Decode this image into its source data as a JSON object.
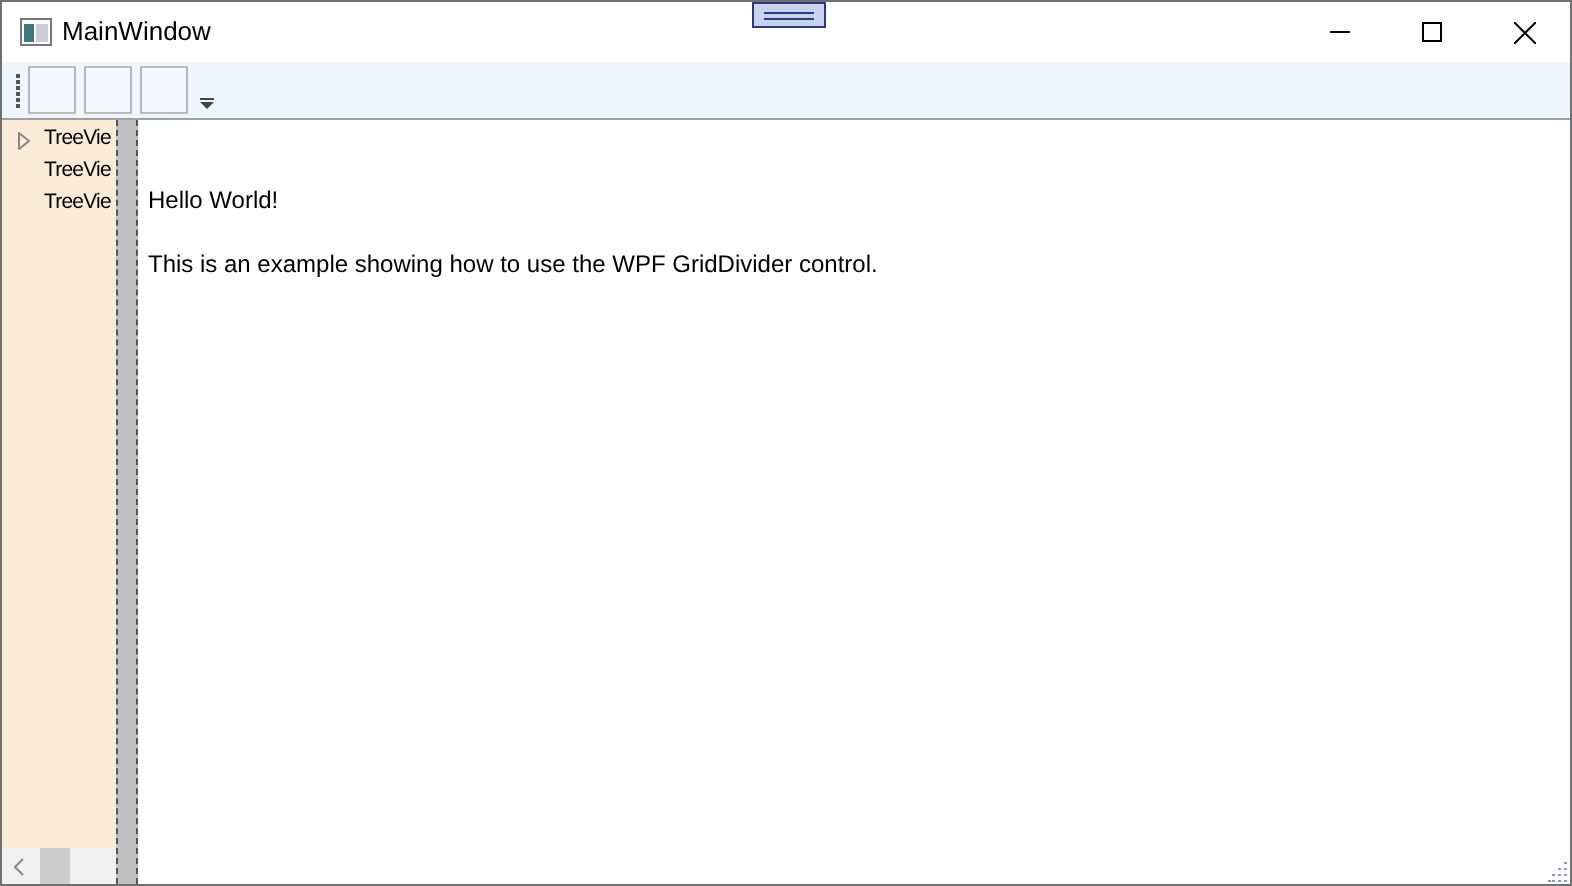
{
  "window": {
    "title": "MainWindow"
  },
  "toolbar": {
    "buttons": [
      {
        "kind": "empty"
      },
      {
        "kind": "empty"
      },
      {
        "kind": "empty"
      }
    ]
  },
  "tree": {
    "items": [
      {
        "label": "TreeVie",
        "kind": "parent",
        "expanded": false
      },
      {
        "label": "TreeVie",
        "kind": "leaf"
      },
      {
        "label": "TreeVie",
        "kind": "leaf"
      }
    ]
  },
  "content": {
    "heading": "Hello World!",
    "text": "This is an example showing how to use the WPF GridDivider control."
  }
}
